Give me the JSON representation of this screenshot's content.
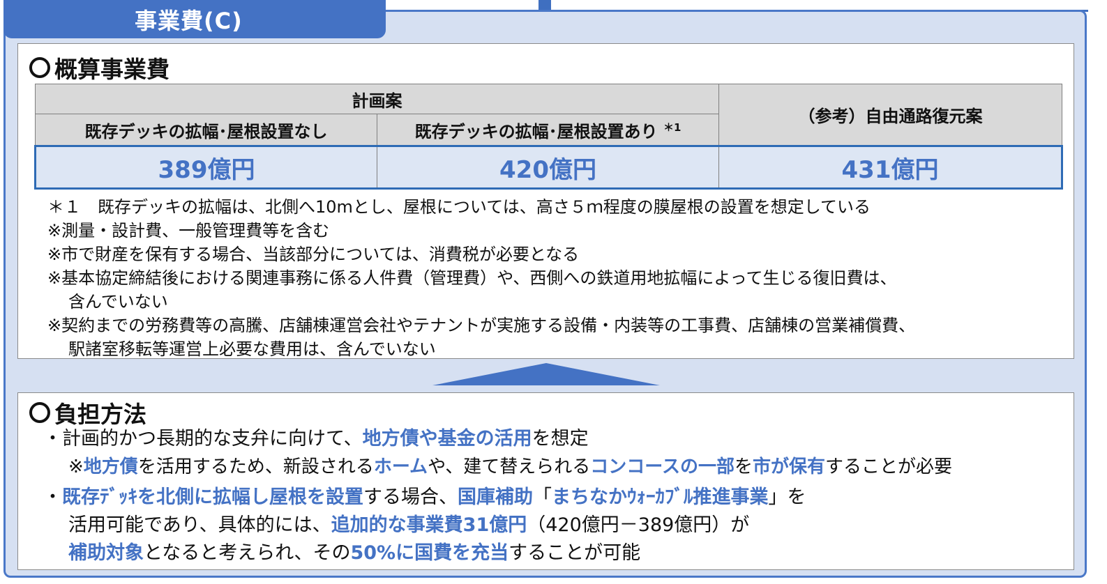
{
  "title": "事業費(C)",
  "estimate": {
    "heading": "概算事業費",
    "plan_header": "計画案",
    "col1_header": "既存デッキの拡幅･屋根設置なし",
    "col2_header": "既存デッキの拡幅･屋根設置あり",
    "col2_mark": "＊1",
    "col3_header": "（参考）自由通路復元案",
    "col1_value": "389億円",
    "col2_value": "420億円",
    "col3_value": "431億円",
    "notes": [
      "＊１　既存デッキの拡幅は、北側へ10mとし、屋根については、高さ５ｍ程度の膜屋根の設置を想定している",
      "※測量・設計費、一般管理費等を含む",
      "※市で財産を保有する場合、当該部分については、消費税が必要となる",
      "※基本協定締結後における関連事務に係る人件費（管理費）や、西側への鉄道用地拡幅によって生じる復旧費は、",
      "含んでいない",
      "※契約までの労務費等の高騰、店舗棟運営会社やテナントが実施する設備・内装等の工事費、店舗棟の営業補償費、",
      "駅諸室移転等運営上必要な費用は、含んでいない"
    ]
  },
  "burden": {
    "heading": "負担方法",
    "l1": [
      "・計画的かつ長期的な支弁に向けて、",
      "地方債や基金の活用",
      "を想定"
    ],
    "l2": [
      "※",
      "地方債",
      "を活用するため、新設される",
      "ホーム",
      "や、建て替えられる",
      "コンコースの一部",
      "を",
      "市が保有",
      "することが必要"
    ],
    "l3": [
      "・",
      "既存ﾃﾞｯｷを北側に拡幅し屋根を設置",
      "する場合、",
      "国庫補助",
      "「",
      "まちなかｳｫｰｶﾌﾞﾙ推進事業",
      "」を"
    ],
    "l4": [
      "活用可能であり、具体的には、",
      "追加的な事業費31億円",
      "（420億円－389億円）が"
    ],
    "l5": [
      "補助対象",
      "となると考えられ、その",
      "50%に国費を充当",
      "することが可能"
    ]
  }
}
